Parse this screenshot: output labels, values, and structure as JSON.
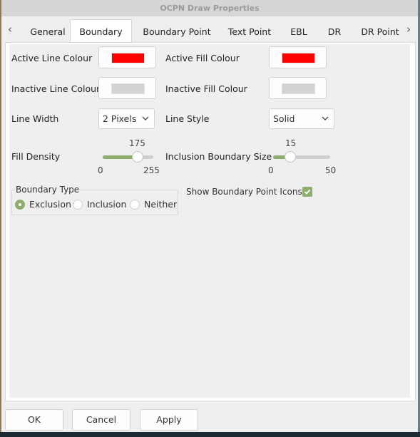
{
  "window": {
    "title": "OCPN Draw Properties"
  },
  "tabs": {
    "scroll_left_icon": "‹",
    "scroll_right_icon": "›",
    "items": [
      {
        "label": "General",
        "active": false
      },
      {
        "label": "Boundary",
        "active": true
      },
      {
        "label": "Boundary Point",
        "active": false
      },
      {
        "label": "Text Point",
        "active": false
      },
      {
        "label": "EBL",
        "active": false
      },
      {
        "label": "DR",
        "active": false
      },
      {
        "label": "DR Point",
        "active": false
      }
    ]
  },
  "boundary": {
    "active_line_colour": {
      "label": "Active Line Colour",
      "color": "#ff0000"
    },
    "active_fill_colour": {
      "label": "Active Fill Colour",
      "color": "#ff0000"
    },
    "inactive_line_colour": {
      "label": "Inactive Line Colour",
      "color": "#d3d3d3"
    },
    "inactive_fill_colour": {
      "label": "Inactive Fill Colour",
      "color": "#d3d3d3"
    },
    "line_width": {
      "label": "Line Width",
      "value": "2 Pixels"
    },
    "line_style": {
      "label": "Line Style",
      "value": "Solid"
    },
    "fill_density": {
      "label": "Fill Density",
      "value": "175",
      "min": "0",
      "max": "255"
    },
    "inclusion_size": {
      "label": "Inclusion Boundary Size",
      "value": "15",
      "min": "0",
      "max": "50"
    },
    "boundary_type": {
      "title": "Boundary Type",
      "options": [
        {
          "label": "Exclusion",
          "selected": true
        },
        {
          "label": "Inclusion",
          "selected": false
        },
        {
          "label": "Neither",
          "selected": false
        }
      ]
    },
    "show_point_icons": {
      "label": "Show Boundary Point Icons",
      "checked": true
    }
  },
  "buttons": {
    "ok": "OK",
    "cancel": "Cancel",
    "apply": "Apply"
  },
  "colors": {
    "accent": "#8fad6c"
  }
}
